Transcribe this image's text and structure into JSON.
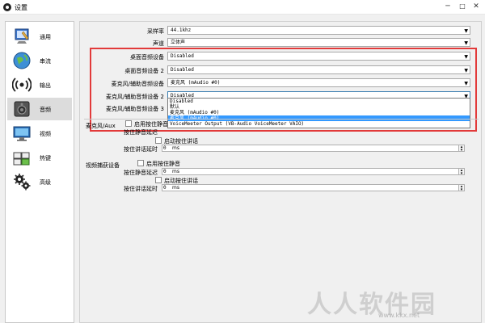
{
  "window": {
    "title": "设置"
  },
  "titlebar": {
    "minimize": "─",
    "maximize": "□",
    "close": "✕"
  },
  "sidebar": {
    "items": [
      {
        "label": "通用"
      },
      {
        "label": "串流"
      },
      {
        "label": "输出"
      },
      {
        "label": "音频",
        "active": true
      },
      {
        "label": "视频"
      },
      {
        "label": "热键"
      },
      {
        "label": "高级"
      }
    ]
  },
  "audio": {
    "sample_rate": {
      "label": "采样率",
      "value": "44.1khz"
    },
    "channels": {
      "label": "声道",
      "value": "立体声"
    },
    "desktop1": {
      "label": "桌面音频设备",
      "value": "Disabled"
    },
    "desktop2": {
      "label": "桌面音频设备 2",
      "value": "Disabled"
    },
    "mic1": {
      "label": "麦克风/辅助音频设备",
      "value": "麦克风 (mAudio #0)"
    },
    "mic2": {
      "label": "麦克风/辅助音频设备 2",
      "value": "Disabled"
    },
    "mic3": {
      "label": "麦克风/辅助音频设备 3"
    },
    "dropdown_options": [
      "Disabled",
      "默认",
      "麦克风 (mAudio #0)",
      "麦克风 (mAudio #0)",
      "VoiceMeeter Output (VB-Audio VoiceMeeter VAIO)"
    ],
    "selected_option_index": 3
  },
  "mic_aux": {
    "group": "麦克风/Aux",
    "push_to_mute": "启用按住静音",
    "push_to_mute_delay": "按住静音延迟",
    "push_to_talk": "启动按住讲话",
    "push_to_talk_delay": "按住讲话延时",
    "value": "0",
    "unit": "ms"
  },
  "desktop_device": {
    "group": "视频捕获设备",
    "push_to_mute": "启用按住静音",
    "push_to_mute_delay": "按住静音延迟",
    "push_to_talk": "启动按住讲话",
    "push_to_talk_delay": "按住讲话延时",
    "value": "0",
    "unit": "ms"
  },
  "watermark": {
    "text": "人人软件园",
    "url": "www.kkx.net"
  },
  "colors": {
    "highlight_box": "#e23a3a",
    "selection": "#3399ff"
  }
}
